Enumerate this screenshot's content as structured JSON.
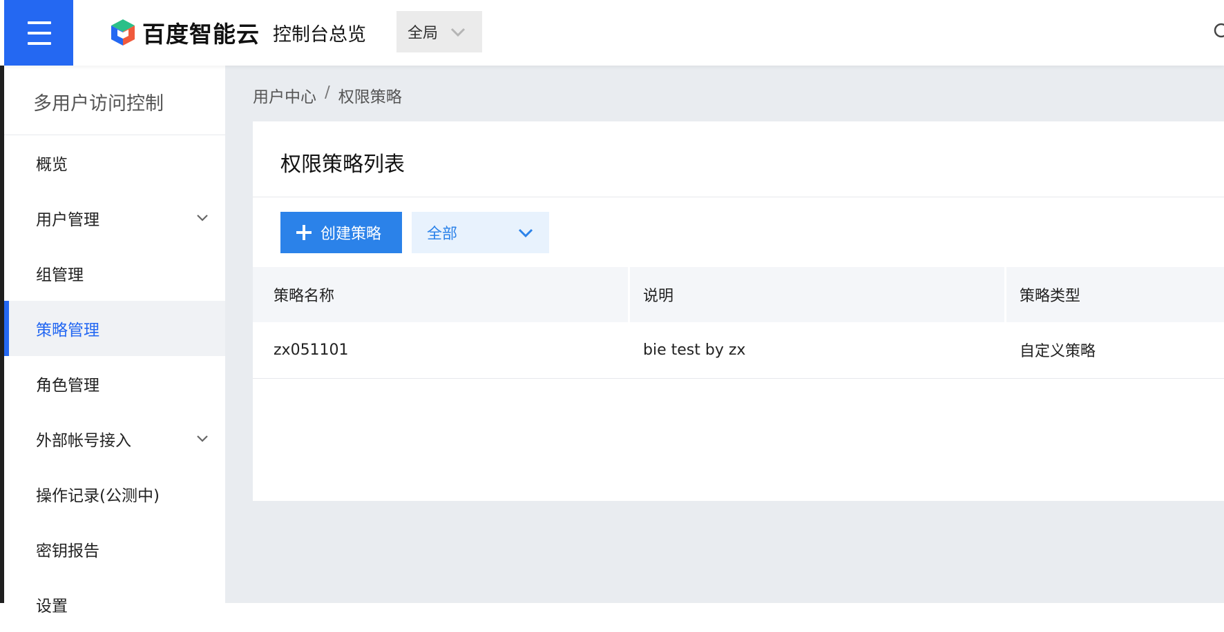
{
  "header": {
    "logo_text": "百度智能云",
    "console_title": "控制台总览",
    "region_selected": "全局"
  },
  "sidebar": {
    "title": "多用户访问控制",
    "items": [
      {
        "label": "概览"
      },
      {
        "label": "用户管理"
      },
      {
        "label": "组管理"
      },
      {
        "label": "策略管理"
      },
      {
        "label": "角色管理"
      },
      {
        "label": "外部帐号接入"
      },
      {
        "label": "操作记录(公测中)"
      },
      {
        "label": "密钥报告"
      },
      {
        "label": "设置"
      }
    ]
  },
  "breadcrumb": {
    "parent": "用户中心",
    "separator": "/",
    "current": "权限策略"
  },
  "main": {
    "card_title": "权限策略列表",
    "create_button": "创建策略",
    "filter_selected": "全部",
    "table": {
      "columns": [
        "策略名称",
        "说明",
        "策略类型"
      ],
      "rows": [
        [
          "zx051101",
          "bie test by zx",
          "自定义策略"
        ]
      ]
    }
  },
  "colors": {
    "brand_blue": "#2468f2",
    "button_blue": "#2b82e9"
  }
}
